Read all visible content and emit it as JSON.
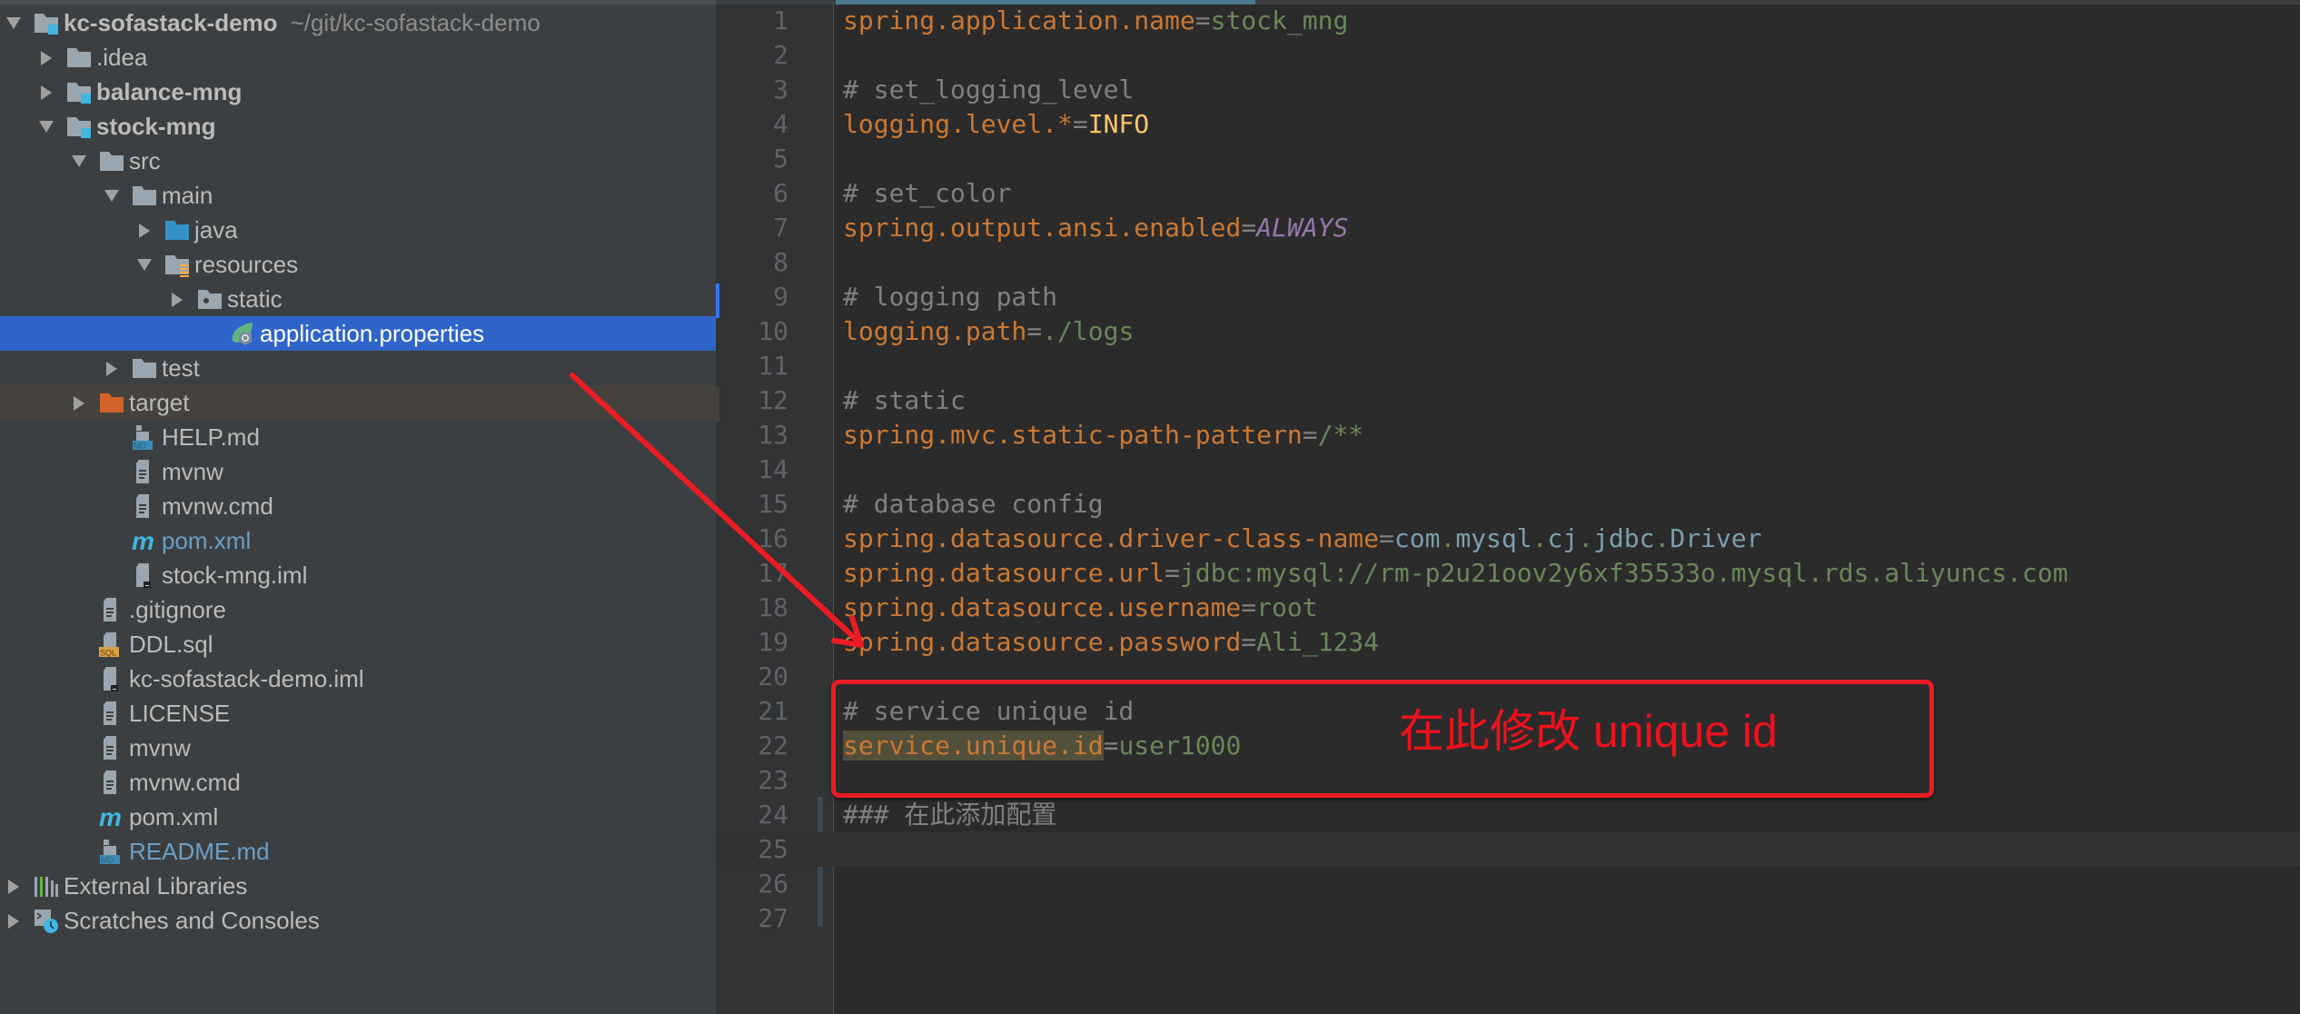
{
  "project_tree": {
    "root_hint": "~/git/kc-sofastack-demo",
    "items": [
      {
        "label": "kc-sofastack-demo",
        "level": 0,
        "arrow": "expanded",
        "icon": "module-folder-icon",
        "bold": true,
        "hint": "~/git/kc-sofastack-demo"
      },
      {
        "label": ".idea",
        "level": 1,
        "arrow": "collapsed",
        "icon": "folder-icon"
      },
      {
        "label": "balance-mng",
        "level": 1,
        "arrow": "collapsed",
        "icon": "module-folder-icon",
        "bold": true
      },
      {
        "label": "stock-mng",
        "level": 1,
        "arrow": "expanded",
        "icon": "module-folder-icon",
        "bold": true
      },
      {
        "label": "src",
        "level": 2,
        "arrow": "expanded",
        "icon": "folder-icon"
      },
      {
        "label": "main",
        "level": 3,
        "arrow": "expanded",
        "icon": "folder-icon"
      },
      {
        "label": "java",
        "level": 4,
        "arrow": "collapsed",
        "icon": "source-folder-icon"
      },
      {
        "label": "resources",
        "level": 4,
        "arrow": "expanded",
        "icon": "resources-folder-icon"
      },
      {
        "label": "static",
        "level": 5,
        "arrow": "collapsed",
        "icon": "web-folder-icon"
      },
      {
        "label": "application.properties",
        "level": 6,
        "arrow": "none",
        "icon": "spring-properties-icon",
        "selected": true
      },
      {
        "label": "test",
        "level": 3,
        "arrow": "collapsed",
        "icon": "folder-icon"
      },
      {
        "label": "target",
        "level": 2,
        "arrow": "collapsed",
        "icon": "excluded-folder-icon",
        "excluded": true
      },
      {
        "label": "HELP.md",
        "level": 3,
        "arrow": "none",
        "icon": "markdown-file-icon"
      },
      {
        "label": "mvnw",
        "level": 3,
        "arrow": "none",
        "icon": "text-file-icon"
      },
      {
        "label": "mvnw.cmd",
        "level": 3,
        "arrow": "none",
        "icon": "text-file-icon"
      },
      {
        "label": "pom.xml",
        "level": 3,
        "arrow": "none",
        "icon": "maven-icon",
        "blue": true
      },
      {
        "label": "stock-mng.iml",
        "level": 3,
        "arrow": "none",
        "icon": "iml-file-icon"
      },
      {
        "label": ".gitignore",
        "level": 2,
        "arrow": "none",
        "icon": "text-file-icon"
      },
      {
        "label": "DDL.sql",
        "level": 2,
        "arrow": "none",
        "icon": "sql-file-icon"
      },
      {
        "label": "kc-sofastack-demo.iml",
        "level": 2,
        "arrow": "none",
        "icon": "iml-file-icon"
      },
      {
        "label": "LICENSE",
        "level": 2,
        "arrow": "none",
        "icon": "text-file-icon"
      },
      {
        "label": "mvnw",
        "level": 2,
        "arrow": "none",
        "icon": "text-file-icon"
      },
      {
        "label": "mvnw.cmd",
        "level": 2,
        "arrow": "none",
        "icon": "text-file-icon"
      },
      {
        "label": "pom.xml",
        "level": 2,
        "arrow": "none",
        "icon": "maven-icon"
      },
      {
        "label": "README.md",
        "level": 2,
        "arrow": "none",
        "icon": "markdown-file-icon",
        "blue": true
      },
      {
        "label": "External Libraries",
        "level": 0,
        "arrow": "collapsed",
        "icon": "libraries-icon"
      },
      {
        "label": "Scratches and Consoles",
        "level": 0,
        "arrow": "collapsed",
        "icon": "scratches-icon"
      }
    ]
  },
  "editor": {
    "file": "application.properties",
    "caret_line": 25,
    "lines": [
      [
        {
          "t": "spring.application.name",
          "s": "k"
        },
        {
          "t": "=",
          "s": "eq"
        },
        {
          "t": "stock_mng",
          "s": "v"
        }
      ],
      [],
      [
        {
          "t": "# set_logging_level",
          "s": "c"
        }
      ],
      [
        {
          "t": "logging.level.",
          "s": "k"
        },
        {
          "t": "*",
          "s": "k"
        },
        {
          "t": "=",
          "s": "eq"
        },
        {
          "t": "INFO",
          "s": "const"
        }
      ],
      [],
      [
        {
          "t": "# set_color",
          "s": "c"
        }
      ],
      [
        {
          "t": "spring.output.ansi.enabled",
          "s": "k"
        },
        {
          "t": "=",
          "s": "eq"
        },
        {
          "t": "ALWAYS",
          "s": "enum"
        }
      ],
      [],
      [
        {
          "t": "# logging path",
          "s": "c"
        }
      ],
      [
        {
          "t": "logging.path",
          "s": "k"
        },
        {
          "t": "=",
          "s": "eq"
        },
        {
          "t": "./logs",
          "s": "v"
        }
      ],
      [],
      [
        {
          "t": "# static",
          "s": "c"
        }
      ],
      [
        {
          "t": "spring.mvc.static-path-pattern",
          "s": "k"
        },
        {
          "t": "=",
          "s": "eq"
        },
        {
          "t": "/**",
          "s": "v"
        }
      ],
      [],
      [
        {
          "t": "# database config",
          "s": "c"
        }
      ],
      [
        {
          "t": "spring.datasource.driver-class-name",
          "s": "k"
        },
        {
          "t": "=",
          "s": "eq"
        },
        {
          "t": "com",
          "s": "cls"
        },
        {
          "t": ".",
          "s": "v"
        },
        {
          "t": "mysql",
          "s": "cls"
        },
        {
          "t": ".",
          "s": "v"
        },
        {
          "t": "cj",
          "s": "cls"
        },
        {
          "t": ".",
          "s": "v"
        },
        {
          "t": "jdbc",
          "s": "cls"
        },
        {
          "t": ".",
          "s": "v"
        },
        {
          "t": "Driver",
          "s": "cls"
        }
      ],
      [
        {
          "t": "spring.datasource.url",
          "s": "k"
        },
        {
          "t": "=",
          "s": "eq"
        },
        {
          "t": "jdbc:mysql://rm-p2u21oov2y6xf35533o.mysql.rds.aliyuncs.com",
          "s": "v"
        }
      ],
      [
        {
          "t": "spring.datasource.username",
          "s": "k"
        },
        {
          "t": "=",
          "s": "eq"
        },
        {
          "t": "root",
          "s": "v"
        }
      ],
      [
        {
          "t": "spring.datasource.password",
          "s": "k"
        },
        {
          "t": "=",
          "s": "eq"
        },
        {
          "t": "Ali_1234",
          "s": "v"
        }
      ],
      [],
      [
        {
          "t": "# service unique id",
          "s": "c"
        }
      ],
      [
        {
          "t": "service.unique.id",
          "s": "k hl"
        },
        {
          "t": "=",
          "s": "eq"
        },
        {
          "t": "user1000",
          "s": "v"
        }
      ],
      [],
      [
        {
          "t": "### 在此添加配置",
          "s": "c"
        }
      ],
      [],
      [],
      []
    ]
  },
  "annotation": {
    "text": "在此修改 unique id",
    "color": "#ec1c24"
  },
  "colors": {
    "selection": "#2f65ca",
    "panel_bg": "#3c3f41",
    "editor_bg": "#2b2b2b",
    "keyword": "#cc7832",
    "value": "#6a8759",
    "comment": "#808080"
  }
}
